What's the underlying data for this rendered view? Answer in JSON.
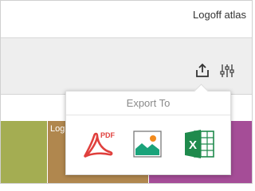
{
  "header": {
    "title": "Logoff atlas"
  },
  "toolbar": {
    "export_icon": "export-share-icon",
    "settings_icon": "sliders-settings-icon"
  },
  "content": {
    "tiles": [
      {
        "label": "",
        "color": "#a4ad52"
      },
      {
        "label": "Log",
        "color": "#b0874e"
      },
      {
        "label": "",
        "color": "#a54d97"
      }
    ]
  },
  "export_popover": {
    "title": "Export To",
    "options": [
      {
        "icon": "pdf-icon",
        "icon_text": "PDF",
        "color": "#e0403d"
      },
      {
        "icon": "image-icon",
        "color": "#1aa37a"
      },
      {
        "icon": "excel-icon",
        "icon_text": "X",
        "color": "#1f8a4c"
      }
    ]
  }
}
